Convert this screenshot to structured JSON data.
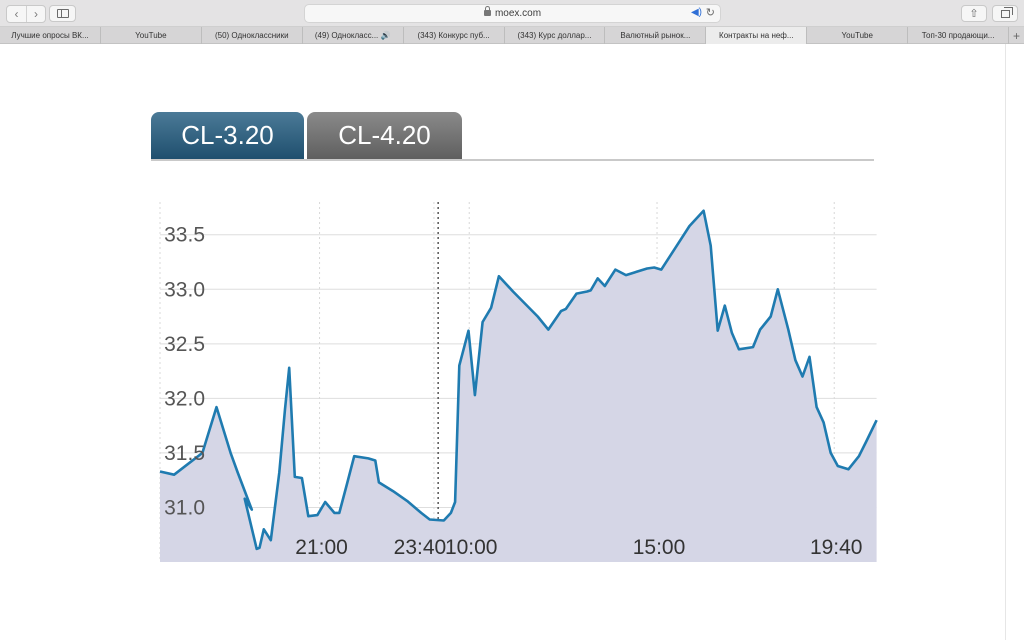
{
  "browser": {
    "address": "moex.com",
    "tabs": [
      {
        "label": "Лучшие опросы ВК..."
      },
      {
        "label": "YouTube"
      },
      {
        "label": "(50) Одноклассники"
      },
      {
        "label": "(49) Однокласс... 🔊"
      },
      {
        "label": "(343) Конкурс пуб..."
      },
      {
        "label": "(343) Курс доллар..."
      },
      {
        "label": "Валютный рынок..."
      },
      {
        "label": "Контракты на неф..."
      },
      {
        "label": "YouTube"
      },
      {
        "label": "Топ-30 продающи..."
      }
    ],
    "active_tab_index": 7
  },
  "chart_tabs": [
    {
      "label": "CL-3.20",
      "active": true
    },
    {
      "label": "CL-4.20",
      "active": false
    }
  ],
  "colors": {
    "line": "#1f7bb0",
    "fill": "#d5d6e6",
    "active_tab": "#2f5f7f",
    "inactive_tab": "#707070"
  },
  "chart_data": {
    "type": "area",
    "title": "",
    "xlabel": "",
    "ylabel": "",
    "ylim": [
      30.5,
      33.8
    ],
    "xlim": [
      0,
      100
    ],
    "y_ticks": [
      "31.0",
      "31.5",
      "32.0",
      "32.5",
      "33.0",
      "33.5"
    ],
    "y_tick_values": [
      31.0,
      31.5,
      32.0,
      32.5,
      33.0,
      33.5
    ],
    "x_ticks": [
      {
        "label": "21:00",
        "pos": 22.6
      },
      {
        "label": "23:40",
        "pos": 38.8
      },
      {
        "label": "10:00",
        "pos": 43.8
      },
      {
        "label": "15:00",
        "pos": 70.4
      },
      {
        "label": "19:40",
        "pos": 95.5
      }
    ],
    "session_break_pos": 39.4,
    "grid": true,
    "series": [
      {
        "values": [
          [
            0,
            31.33
          ],
          [
            2,
            31.3
          ],
          [
            4,
            31.4
          ],
          [
            6,
            31.5
          ],
          [
            8,
            31.92
          ],
          [
            10,
            31.5
          ],
          [
            11,
            31.32
          ],
          [
            13,
            30.98
          ],
          [
            12,
            31.08
          ],
          [
            13.7,
            30.62
          ],
          [
            14.1,
            30.63
          ],
          [
            14.7,
            30.8
          ],
          [
            15.7,
            30.7
          ],
          [
            16.9,
            31.32
          ],
          [
            17.7,
            31.9
          ],
          [
            18.3,
            32.28
          ],
          [
            19.1,
            31.28
          ],
          [
            20.1,
            31.27
          ],
          [
            21,
            30.92
          ],
          [
            22.3,
            30.93
          ],
          [
            23.4,
            31.05
          ],
          [
            24.7,
            30.95
          ],
          [
            25.4,
            30.95
          ],
          [
            26.5,
            31.22
          ],
          [
            27.5,
            31.47
          ],
          [
            29.5,
            31.45
          ],
          [
            30.5,
            31.43
          ],
          [
            31,
            31.23
          ],
          [
            33,
            31.15
          ],
          [
            35,
            31.06
          ],
          [
            37,
            30.95
          ],
          [
            38.2,
            30.89
          ],
          [
            40.2,
            30.88
          ],
          [
            41.2,
            30.95
          ],
          [
            41.8,
            31.05
          ],
          [
            42.4,
            32.3
          ],
          [
            43.7,
            32.62
          ],
          [
            44.6,
            32.03
          ],
          [
            45.7,
            32.7
          ],
          [
            46.9,
            32.83
          ],
          [
            48,
            33.12
          ],
          [
            50,
            32.98
          ],
          [
            53.5,
            32.75
          ],
          [
            55,
            32.63
          ],
          [
            56.8,
            32.8
          ],
          [
            57.5,
            32.82
          ],
          [
            59,
            32.96
          ],
          [
            60.5,
            32.98
          ],
          [
            61,
            32.99
          ],
          [
            62,
            33.1
          ],
          [
            63,
            33.03
          ],
          [
            64.5,
            33.18
          ],
          [
            66,
            33.13
          ],
          [
            69,
            33.19
          ],
          [
            70,
            33.2
          ],
          [
            71,
            33.18
          ],
          [
            73,
            33.38
          ],
          [
            75,
            33.58
          ],
          [
            77,
            33.72
          ],
          [
            78,
            33.4
          ],
          [
            79,
            32.62
          ],
          [
            80,
            32.85
          ],
          [
            81,
            32.6
          ],
          [
            82,
            32.45
          ],
          [
            84,
            32.47
          ],
          [
            85,
            32.63
          ],
          [
            86.5,
            32.75
          ],
          [
            87.5,
            33.0
          ],
          [
            89,
            32.63
          ],
          [
            90,
            32.35
          ],
          [
            91,
            32.2
          ],
          [
            92,
            32.38
          ],
          [
            93,
            31.92
          ],
          [
            94,
            31.78
          ],
          [
            95,
            31.5
          ],
          [
            96,
            31.38
          ],
          [
            97.5,
            31.35
          ],
          [
            99,
            31.47
          ],
          [
            100,
            31.6
          ],
          [
            101.5,
            31.8
          ]
        ]
      }
    ]
  }
}
